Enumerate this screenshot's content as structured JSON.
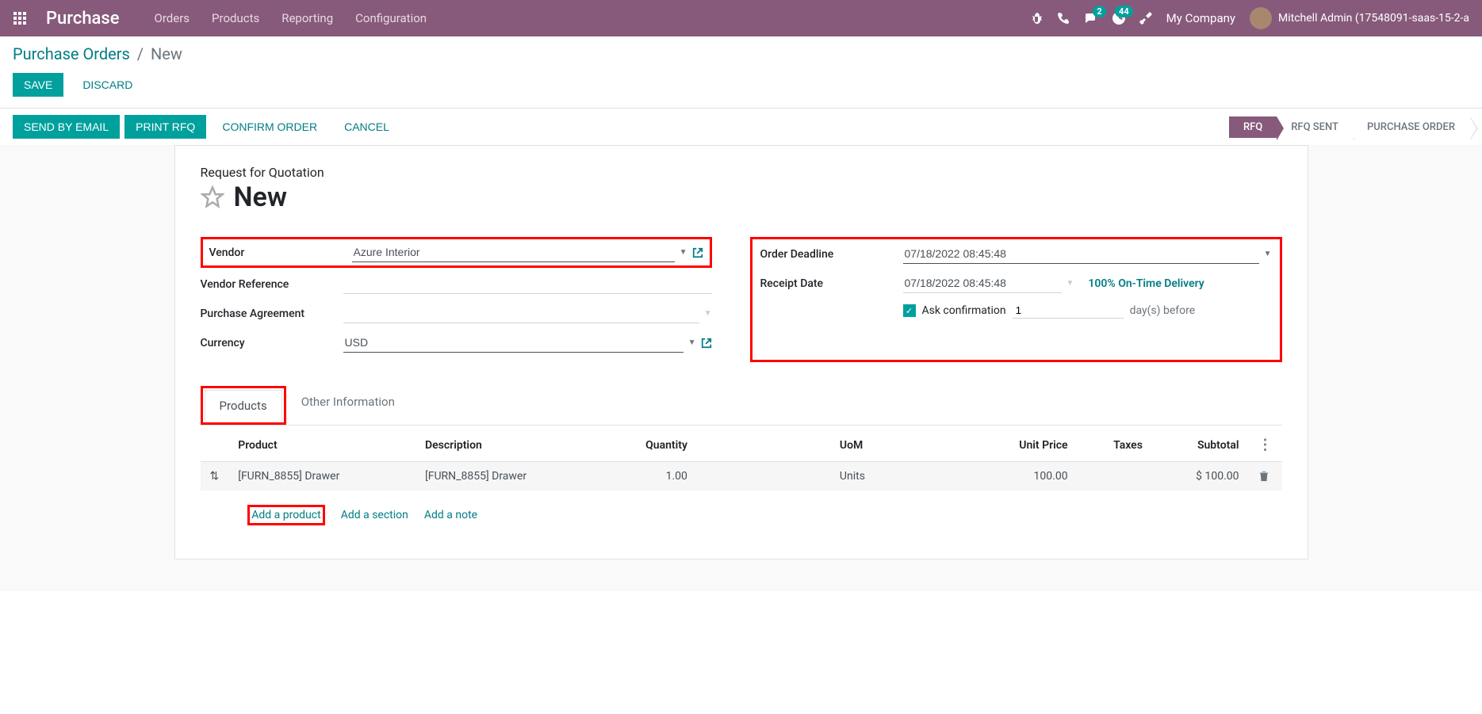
{
  "navbar": {
    "app_name": "Purchase",
    "menu": {
      "orders": "Orders",
      "products": "Products",
      "reporting": "Reporting",
      "configuration": "Configuration"
    },
    "badges": {
      "chat_count": "2",
      "activity_count": "44"
    },
    "company": "My Company",
    "user": "Mitchell Admin (17548091-saas-15-2-a"
  },
  "breadcrumb": {
    "root": "Purchase Orders",
    "current": "New"
  },
  "controls": {
    "save": "Save",
    "discard": "Discard"
  },
  "statusbar": {
    "send_email": "Send by Email",
    "print_rfq": "Print RFQ",
    "confirm": "Confirm Order",
    "cancel": "Cancel",
    "steps": {
      "rfq": "RFQ",
      "rfq_sent": "RFQ Sent",
      "po": "Purchase Order"
    }
  },
  "form": {
    "subtitle": "Request for Quotation",
    "title": "New",
    "left": {
      "vendor_label": "Vendor",
      "vendor_value": "Azure Interior",
      "ref_label": "Vendor Reference",
      "ref_value": "",
      "agreement_label": "Purchase Agreement",
      "agreement_value": "",
      "currency_label": "Currency",
      "currency_value": "USD"
    },
    "right": {
      "deadline_label": "Order Deadline",
      "deadline_value": "07/18/2022 08:45:48",
      "receipt_label": "Receipt Date",
      "receipt_value": "07/18/2022 08:45:48",
      "ontime": "100% On-Time Delivery",
      "ask_confirm": "Ask confirmation",
      "days_value": "1",
      "days_label": "day(s) before"
    }
  },
  "tabs": {
    "products": "Products",
    "other": "Other Information"
  },
  "table": {
    "headers": {
      "product": "Product",
      "description": "Description",
      "quantity": "Quantity",
      "uom": "UoM",
      "unit_price": "Unit Price",
      "taxes": "Taxes",
      "subtotal": "Subtotal"
    },
    "rows": [
      {
        "product": "[FURN_8855] Drawer",
        "description": "[FURN_8855] Drawer",
        "quantity": "1.00",
        "uom": "Units",
        "unit_price": "100.00",
        "taxes": "",
        "subtotal": "$ 100.00"
      }
    ],
    "add_product": "Add a product",
    "add_section": "Add a section",
    "add_note": "Add a note"
  }
}
